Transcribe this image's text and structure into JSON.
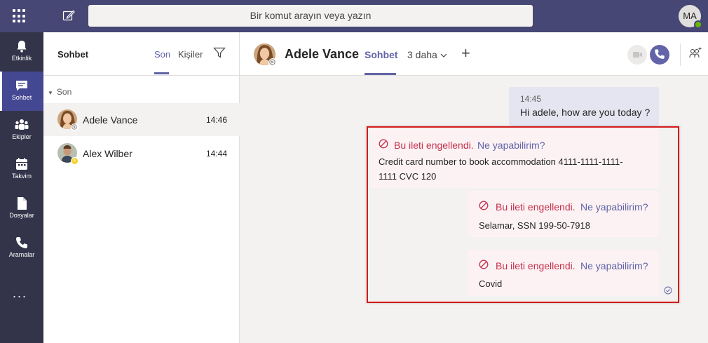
{
  "topbar": {
    "search_placeholder": "Bir komut arayın veya yazın",
    "user_initials": "MA"
  },
  "rail": {
    "items": [
      {
        "label": "Etkinlik",
        "icon": "bell-icon"
      },
      {
        "label": "Sohbet",
        "icon": "chat-icon",
        "active": true
      },
      {
        "label": "Ekipler",
        "icon": "teams-icon"
      },
      {
        "label": "Takvim",
        "icon": "calendar-icon"
      },
      {
        "label": "Dosyalar",
        "icon": "file-icon"
      },
      {
        "label": "Aramalar",
        "icon": "phone-icon"
      }
    ],
    "more": "..."
  },
  "chatlist": {
    "title": "Sohbet",
    "tabs": [
      "Son",
      "Kişiler"
    ],
    "section": "Son",
    "chats": [
      {
        "name": "Adele Vance",
        "time": "14:46"
      },
      {
        "name": "Alex Wilber",
        "time": "14:44"
      }
    ]
  },
  "conversation": {
    "name": "Adele Vance",
    "tab_active": "Sohbet",
    "tab_more": "3 daha",
    "messages": {
      "self": {
        "time": "14:45",
        "text": "Hi adele, how are you today ?"
      },
      "blocked_label": "Bu ileti engellendi.",
      "blocked_link": "Ne yapabilirim?",
      "blocked": [
        {
          "line1": "Credit card number to book accommodation 4111-1111-1111-",
          "line2": "1111 CVC 120"
        },
        {
          "line1": "Selamar, SSN 199-50-7918"
        },
        {
          "line1": "Covid"
        }
      ]
    }
  },
  "colors": {
    "topbar": "#464775",
    "rail": "#33344a",
    "accent": "#6264a7",
    "blocked_red": "#c4314b",
    "highlight_red": "#d61a1a"
  }
}
